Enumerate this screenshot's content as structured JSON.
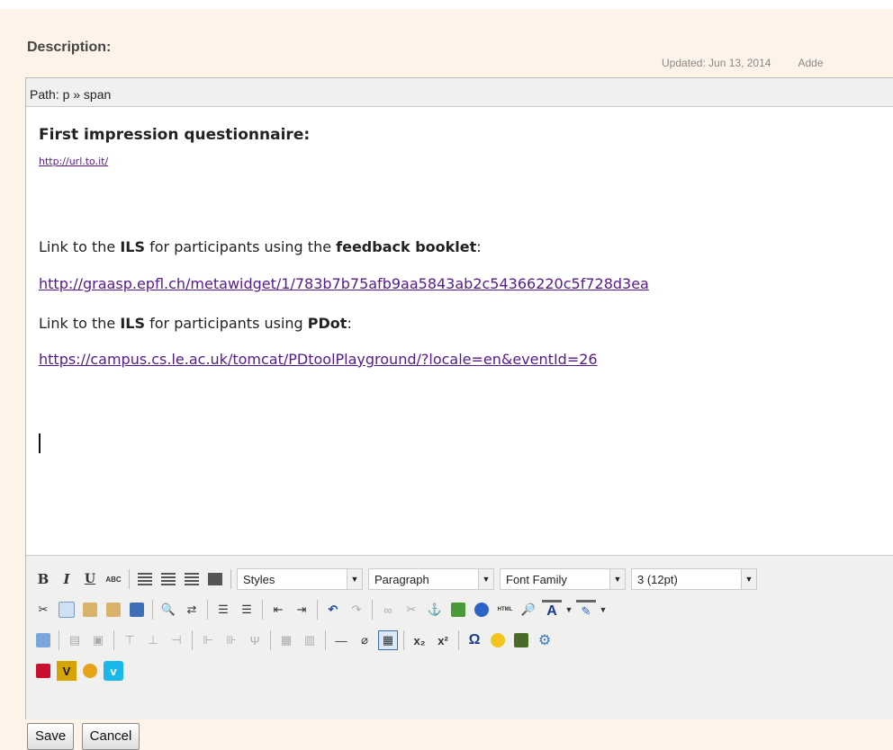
{
  "header": {
    "description_label": "Description:",
    "updated_label": "Updated:",
    "updated_date": "Jun 13, 2014",
    "added_label": "Adde"
  },
  "editor": {
    "path": "Path: p » span",
    "heading": "First impression questionnaire:",
    "first_link": "http://url.to.it/",
    "line1_pre": "Link to the ",
    "line1_ils": "ILS",
    "line1_mid": " for participants using the ",
    "line1_bold": "feedback booklet",
    "line1_end": ":",
    "link1": "http://graasp.epfl.ch/metawidget/1/783b7b75afb9aa5843ab2c54366220c5f728d3ea",
    "line2_pre": "Link to the ",
    "line2_ils": "ILS",
    "line2_mid": " for participants using ",
    "line2_bold": "PDot",
    "line2_end": ":",
    "link2": "https://campus.cs.le.ac.uk/tomcat/PDtoolPlayground/?locale=en&eventId=26"
  },
  "toolbar": {
    "bold": "B",
    "italic": "I",
    "underline": "U",
    "strike": "ABC",
    "styles": "Styles",
    "format": "Paragraph",
    "font_family": "Font Family",
    "font_size": "3 (12pt)",
    "html_label": "HTML"
  },
  "actions": {
    "save": "Save",
    "cancel": "Cancel"
  }
}
